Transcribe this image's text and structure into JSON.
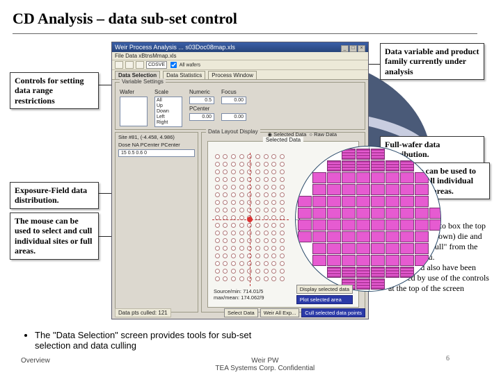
{
  "title": "CD Analysis – data sub-set control",
  "callouts": {
    "controls": "Controls for setting data range restrictions",
    "datavar": "Data variable and product family currently under analysis",
    "fullwafer": "Full-wafer data distribution.",
    "wafer_cull": "The mouse can be used to select and cull individual points or full areas.",
    "expfield": "Exposure-Field data distribution.",
    "expfield_cull": "The mouse can be used to select and cull individual sites or full areas."
  },
  "right_bullets": [
    "Use the mouse to box the top and bottom (shown) die and then select \"Cull\" from the pop-up menu.",
    "Data could also have been selected by use of the controls at the top of the screen"
  ],
  "bottom_bullet": "The \"Data Selection\" screen provides tools for sub-set selection and data culling",
  "footer": {
    "left": "Overview",
    "mid1": "Weir PW",
    "mid2": "TEA Systems Corp. Confidential",
    "page": "6"
  },
  "shot": {
    "title": "Weir Process Analysis ... s03Doc08map.xls",
    "menubar": "File  Data  xBtnsMmap.xls",
    "toolbar": {
      "combo": "CDSVE",
      "chk": "All wafers"
    },
    "tabs": [
      "Data Selection",
      "Data Statistics",
      "Process Window"
    ],
    "vars_panel_title": "Variable Settings",
    "vars": {
      "wafer_label": "Wafer",
      "scale_label": "Scale",
      "numeric_label": "Numeric",
      "focus_label": "Focus",
      "pcenter_label": "PCenter",
      "scale_opts": [
        "All",
        "Up",
        "Down",
        "Left",
        "Right"
      ],
      "numeric_val": "0.5",
      "focus_val": "0.00",
      "pcenter_val": "0.00",
      "pcenter_val2": "0.00"
    },
    "site": {
      "label": "Site #81, (-4.458, 4.986)",
      "hdr": "Dose  NA  PCenter  PCenter",
      "vals": "15       0.5      0.6         0"
    },
    "layout_title": "Data Layout Display",
    "radio_sel": "Selected Data",
    "radio_raw": "Raw Data",
    "sub_title": "Selected Data",
    "status_l1": "Source/min: 714.01/5",
    "status_l2": "max/mean: 174.062/9",
    "status_btn1": "Display selected data",
    "status_btn2": "Plot selected area",
    "bot_status": "Data pts culled: 121",
    "bot_btn1": "Select Data",
    "bot_btn2": "Weir All  Exp...",
    "bot_btn3": "Cull selected data points"
  }
}
